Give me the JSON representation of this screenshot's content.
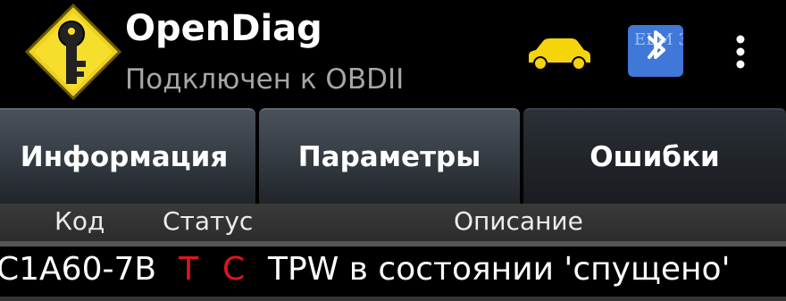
{
  "app": {
    "title": "OpenDiag",
    "subtitle": "Подключен к OBDII",
    "icon": "key-diamond-icon"
  },
  "toolbar": {
    "car_icon": "car-icon",
    "bluetooth_icon": "bluetooth-icon",
    "bluetooth_badge_text": "ELM 327",
    "overflow_icon": "overflow-menu-icon"
  },
  "tabs": [
    {
      "label": "Информация",
      "selected": false
    },
    {
      "label": "Параметры",
      "selected": false
    },
    {
      "label": "Ошибки",
      "selected": true
    }
  ],
  "table": {
    "headers": {
      "code": "Код",
      "status": "Статус",
      "description": "Описание"
    },
    "rows": [
      {
        "code": "C1A60-7B",
        "status": [
          "T",
          "C"
        ],
        "description": "TPW в состоянии 'спущено'"
      }
    ]
  },
  "colors": {
    "background": "#000000",
    "accent_yellow": "#f5d40a",
    "status_red": "#e3141c",
    "subtitle_gray": "#a6a6a6"
  }
}
